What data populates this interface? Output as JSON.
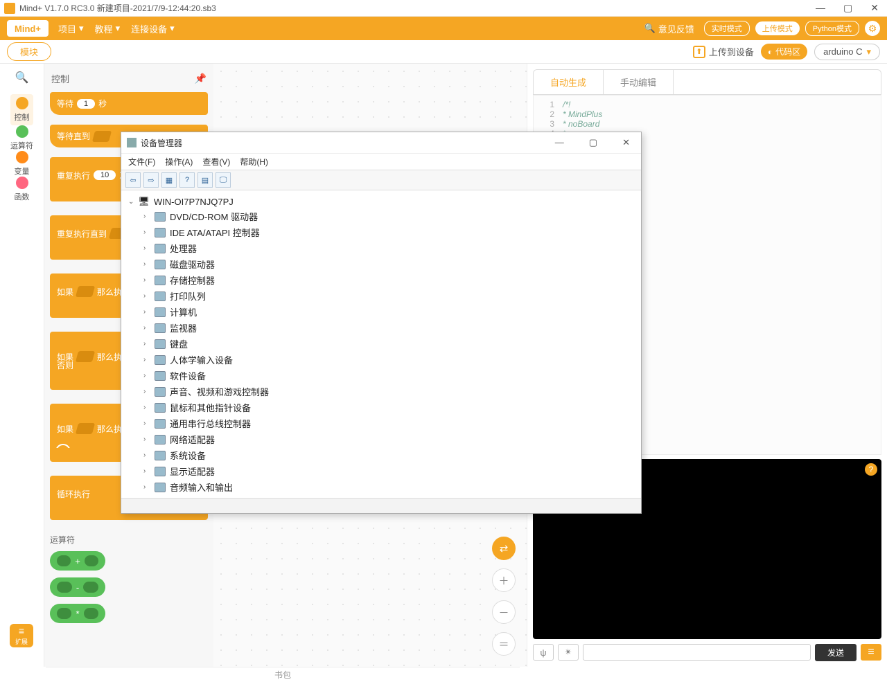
{
  "titlebar": {
    "title": "Mind+  V1.7.0 RC3.0   新建项目-2021/7/9-12:44:20.sb3"
  },
  "menubar": {
    "logo": "Mind+",
    "items": [
      "项目",
      "教程",
      "连接设备"
    ],
    "feedback": "意见反馈",
    "modes": {
      "realtime": "实时模式",
      "upload": "上传模式",
      "python": "Python模式"
    }
  },
  "toolbar": {
    "blocks_tab": "模块",
    "upload_label": "上传到设备",
    "code_area_label": "代码区",
    "language": "arduino C"
  },
  "categories": [
    {
      "label": "控制",
      "color": "#f5a623",
      "active": true
    },
    {
      "label": "运算符",
      "color": "#59c059"
    },
    {
      "label": "变量",
      "color": "#ff8c1a"
    },
    {
      "label": "函数",
      "color": "#ff6680"
    }
  ],
  "palette": {
    "header": "控制",
    "blocks": {
      "wait_label": "等待",
      "wait_value": "1",
      "wait_unit": "秒",
      "wait_until": "等待直到",
      "repeat_label": "重复执行",
      "repeat_value": "10",
      "repeat_unit": "次",
      "repeat_until": "重复执行直到",
      "if_label": "如果",
      "then_label": "那么执行",
      "else_label": "否则",
      "forever": "循环执行"
    },
    "operators_header": "运算符"
  },
  "code_panel": {
    "tab_auto": "自动生成",
    "tab_manual": "手动编辑",
    "lines": [
      {
        "n": "1",
        "t": "/*!"
      },
      {
        "n": "2",
        "t": " * MindPlus"
      },
      {
        "n": "3",
        "t": " * noBoard"
      },
      {
        "n": "4",
        "t": " *"
      }
    ]
  },
  "console_bar": {
    "send": "发送",
    "placeholder": ""
  },
  "extensions_btn": "扩展",
  "bottom_strip": "书包",
  "device_manager": {
    "title": "设备管理器",
    "menu": [
      "文件(F)",
      "操作(A)",
      "查看(V)",
      "帮助(H)"
    ],
    "tool_icons": [
      "⇦",
      "⇨",
      "▦",
      "?",
      "▤",
      "🖵"
    ],
    "root": "WIN-OI7P7NJQ7PJ",
    "nodes": [
      "DVD/CD-ROM 驱动器",
      "IDE ATA/ATAPI 控制器",
      "处理器",
      "磁盘驱动器",
      "存储控制器",
      "打印队列",
      "计算机",
      "监视器",
      "键盘",
      "人体学输入设备",
      "软件设备",
      "声音、视频和游戏控制器",
      "鼠标和其他指针设备",
      "通用串行总线控制器",
      "网络适配器",
      "系统设备",
      "显示适配器",
      "音频输入和输出"
    ]
  }
}
